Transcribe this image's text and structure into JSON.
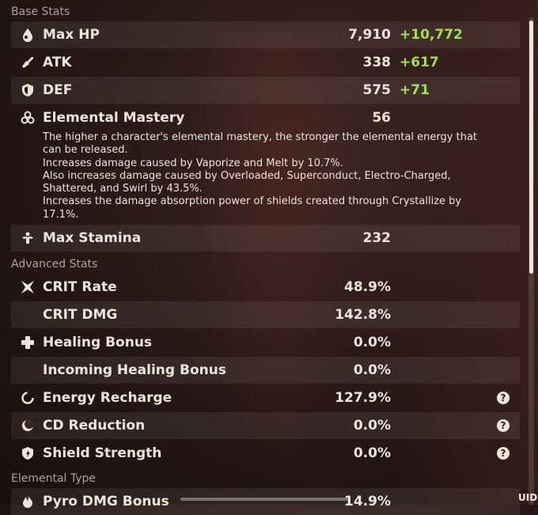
{
  "sections": {
    "base": "Base Stats",
    "advanced": "Advanced Stats",
    "elemental": "Elemental Type"
  },
  "base_stats": [
    {
      "label": "Max HP",
      "value": "7,910",
      "bonus": "+10,772",
      "icon": "hp-drop-icon"
    },
    {
      "label": "ATK",
      "value": "338",
      "bonus": "+617",
      "icon": "sword-icon"
    },
    {
      "label": "DEF",
      "value": "575",
      "bonus": "+71",
      "icon": "shield-icon"
    },
    {
      "label": "Elemental Mastery",
      "value": "56",
      "bonus": "",
      "icon": "mastery-icon"
    },
    {
      "label": "Max Stamina",
      "value": "232",
      "bonus": "",
      "icon": "stamina-icon"
    }
  ],
  "mastery_description": [
    "The higher a character's elemental mastery, the stronger the elemental energy that",
    "can be released.",
    "Increases damage caused by Vaporize and Melt by 10.7%.",
    "Also increases damage caused by Overloaded, Superconduct, Electro-Charged,",
    "Shattered, and Swirl by 43.5%.",
    "Increases the damage absorption power of shields created through Crystallize by",
    "17.1%."
  ],
  "advanced_stats": [
    {
      "label": "CRIT Rate",
      "value": "48.9%",
      "icon": "crit-rate-icon"
    },
    {
      "label": "CRIT DMG",
      "value": "142.8%",
      "icon": ""
    },
    {
      "label": "Healing Bonus",
      "value": "0.0%",
      "icon": "healing-cross-icon"
    },
    {
      "label": "Incoming Healing Bonus",
      "value": "0.0%",
      "icon": ""
    },
    {
      "label": "Energy Recharge",
      "value": "127.9%",
      "icon": "energy-recharge-icon",
      "help": "?"
    },
    {
      "label": "CD Reduction",
      "value": "0.0%",
      "icon": "cd-reduction-icon",
      "help": "?"
    },
    {
      "label": "Shield Strength",
      "value": "0.0%",
      "icon": "shield-strength-icon",
      "help": "?"
    }
  ],
  "elemental_stats": [
    {
      "label": "Pyro DMG Bonus",
      "value": "14.9%",
      "icon": "pyro-icon"
    }
  ],
  "uid_label": "UID:",
  "colors": {
    "bonus": "#9ee24a",
    "text": "#ece5d8"
  }
}
